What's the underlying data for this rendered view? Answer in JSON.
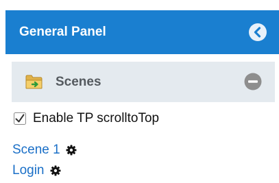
{
  "header": {
    "title": "General Panel",
    "collapse_icon": "chevron-left-circle-icon",
    "background_color": "#1a7fd0"
  },
  "section": {
    "title": "Scenes",
    "icon": "folder-icon",
    "toggle_icon": "minus-circle-icon",
    "background_color": "#e4eaef"
  },
  "option": {
    "label": "Enable TP scrolltoTop",
    "checked": true
  },
  "links": [
    {
      "label": "Scene 1",
      "icon": "gear-icon"
    },
    {
      "label": "Login",
      "icon": "gear-icon"
    }
  ],
  "colors": {
    "link": "#1a6fc7",
    "accent": "#1a7fd0"
  }
}
